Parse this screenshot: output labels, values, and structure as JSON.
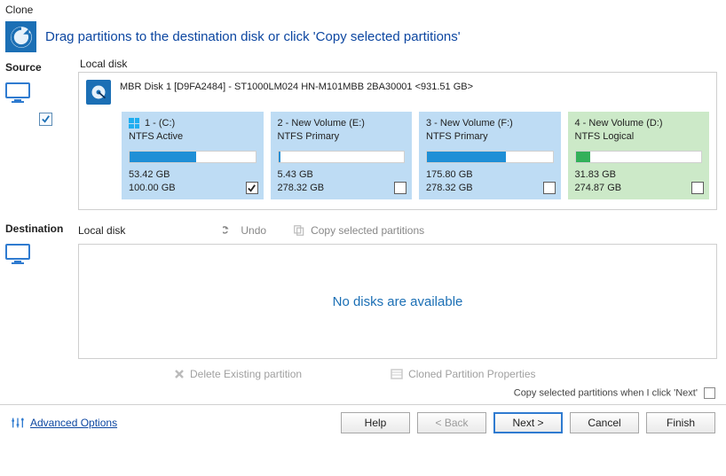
{
  "window": {
    "title": "Clone"
  },
  "hero": {
    "text": "Drag partitions to the destination disk or click 'Copy selected partitions'"
  },
  "source": {
    "label": "Source",
    "local": "Local disk",
    "sourceChecked": true,
    "disk": {
      "title": "MBR Disk 1 [D9FA2484] - ST1000LM024 HN-M101MBB 2BA30001  <931.51 GB>"
    },
    "partitions": [
      {
        "name": "1 -  (C:)",
        "fs": "NTFS Active",
        "used": "53.42 GB",
        "total": "100.00 GB",
        "fillPct": 53,
        "checked": true,
        "winFlag": true,
        "tone": "blue"
      },
      {
        "name": "2 - New Volume (E:)",
        "fs": "NTFS Primary",
        "used": "5.43 GB",
        "total": "278.32 GB",
        "fillPct": 2,
        "checked": false,
        "winFlag": false,
        "tone": "blue"
      },
      {
        "name": "3 - New Volume (F:)",
        "fs": "NTFS Primary",
        "used": "175.80 GB",
        "total": "278.32 GB",
        "fillPct": 63,
        "checked": false,
        "winFlag": false,
        "tone": "blue"
      },
      {
        "name": "4 - New Volume (D:)",
        "fs": "NTFS Logical",
        "used": "31.83 GB",
        "total": "274.87 GB",
        "fillPct": 12,
        "checked": false,
        "winFlag": false,
        "tone": "green"
      }
    ]
  },
  "destination": {
    "label": "Destination",
    "local": "Local disk",
    "undo": "Undo",
    "copySelected": "Copy selected partitions",
    "empty": "No disks are available",
    "deleteExisting": "Delete Existing partition",
    "clonedProps": "Cloned Partition Properties",
    "copyOnNext": "Copy selected partitions when I click 'Next'"
  },
  "footer": {
    "advanced": "Advanced Options",
    "help": "Help",
    "back": "< Back",
    "next": "Next >",
    "cancel": "Cancel",
    "finish": "Finish"
  }
}
